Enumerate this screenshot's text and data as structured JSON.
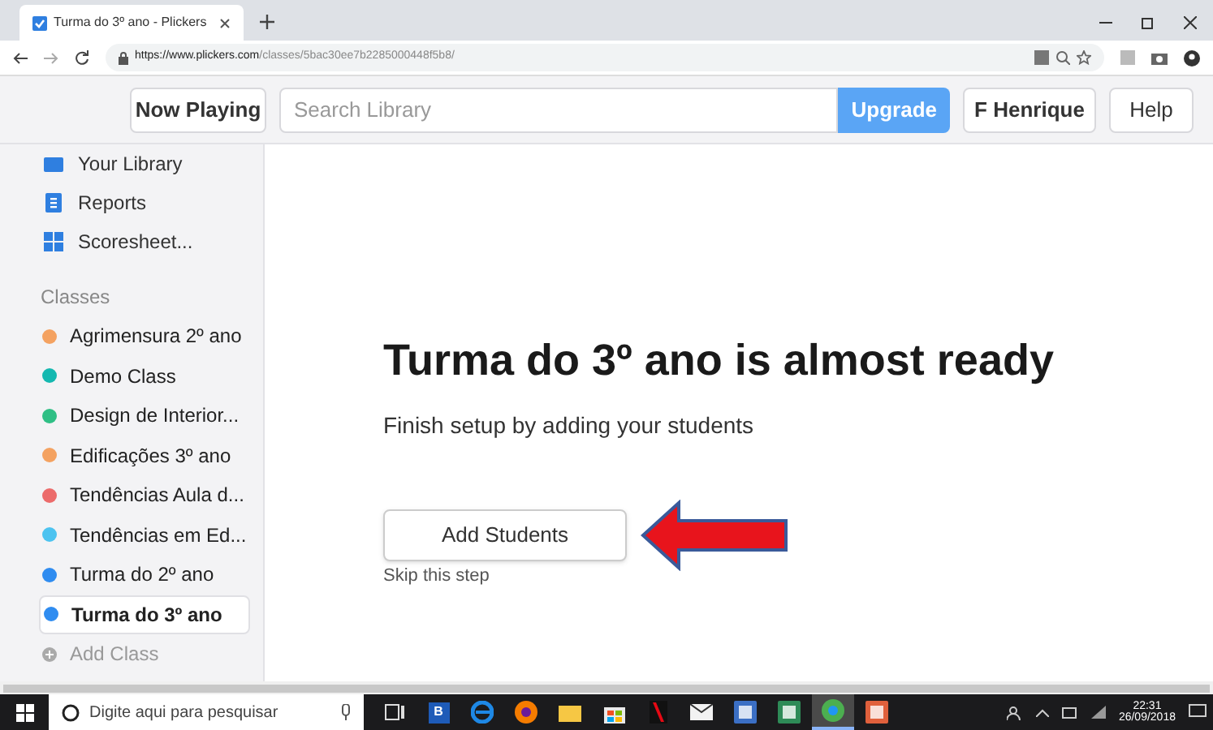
{
  "browser": {
    "tab_title": "Turma do 3º ano - Plickers",
    "url_host": "https://www.plickers.com",
    "url_path": "/classes/5bac30ee7b2285000448f5b8/"
  },
  "header": {
    "now_playing": "Now Playing",
    "search": {
      "placeholder": "Search Library"
    },
    "upgrade": "Upgrade",
    "user": "F Henrique",
    "help": "Help"
  },
  "sidebar": {
    "nav": [
      {
        "label": "Your Library",
        "kind": "library"
      },
      {
        "label": "Reports",
        "kind": "reports"
      },
      {
        "label": "Scoresheet...",
        "kind": "scoresheet"
      }
    ],
    "classes_heading": "Classes",
    "classes": [
      {
        "label": "Agrimensura 2º ano",
        "color": "#f4a261",
        "selected": false
      },
      {
        "label": "Demo Class",
        "color": "#14b8b0",
        "selected": false
      },
      {
        "label": "Design de Interior...",
        "color": "#2fbf85",
        "selected": false
      },
      {
        "label": "Edificações 3º ano",
        "color": "#f4a261",
        "selected": false
      },
      {
        "label": "Tendências Aula d...",
        "color": "#ec6b6b",
        "selected": false
      },
      {
        "label": "Tendências em Ed...",
        "color": "#4cc3f0",
        "selected": false
      },
      {
        "label": "Turma do 2º ano",
        "color": "#2f8cf0",
        "selected": false
      },
      {
        "label": "Turma do 3º ano",
        "color": "#2f8cf0",
        "selected": true
      }
    ],
    "add_class": "Add Class"
  },
  "main": {
    "title": "Turma do 3º ano is almost ready",
    "subtitle": "Finish setup by adding your students",
    "add_students": "Add Students",
    "skip": "Skip this step"
  },
  "taskbar": {
    "search_placeholder": "Digite aqui para pesquisar",
    "apps": [
      {
        "kind": "taskview",
        "selected": false
      },
      {
        "kind": "letter",
        "label": "B",
        "selected": false
      },
      {
        "kind": "edge",
        "selected": false
      },
      {
        "kind": "firefox",
        "selected": false
      },
      {
        "kind": "folder",
        "selected": false
      },
      {
        "kind": "store",
        "selected": false
      },
      {
        "kind": "netflix",
        "selected": false
      },
      {
        "kind": "mail",
        "selected": false
      },
      {
        "kind": "word",
        "selected": false
      },
      {
        "kind": "excel",
        "selected": false
      },
      {
        "kind": "chrome",
        "selected": true
      },
      {
        "kind": "powerpoint",
        "selected": false
      }
    ],
    "time": "22:31",
    "date": "26/09/2018"
  }
}
